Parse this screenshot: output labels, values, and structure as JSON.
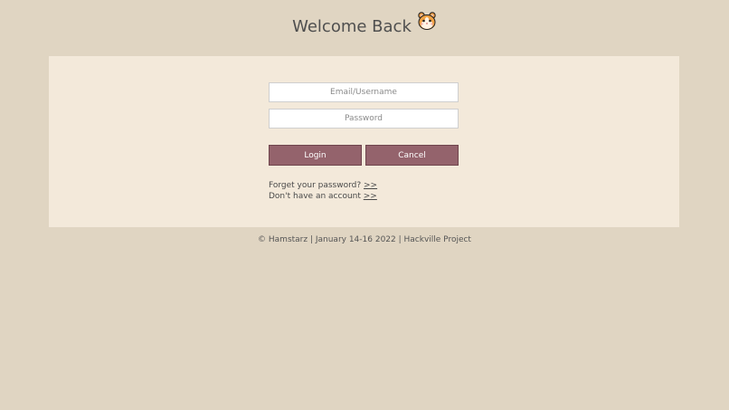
{
  "header": {
    "title": "Welcome Back",
    "icon": "hamster-icon"
  },
  "form": {
    "email_placeholder": "Email/Username",
    "password_placeholder": "Password",
    "login_label": "Login",
    "cancel_label": "Cancel",
    "forgot_text": "Forget your password? ",
    "forgot_link": ">>",
    "signup_text": "Don't have an account ",
    "signup_link": ">>"
  },
  "footer": {
    "text": "© Hamstarz | January 14-16 2022 | Hackville Project"
  },
  "colors": {
    "background": "#e0d5c2",
    "card": "#f3e9da",
    "button": "#94636c"
  }
}
